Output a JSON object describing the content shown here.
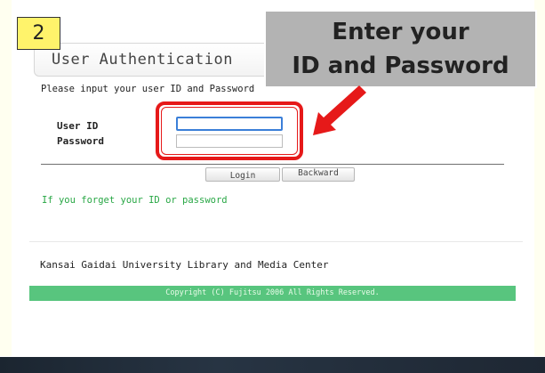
{
  "step_number": "2",
  "callout": {
    "line1": "Enter your",
    "line2": "ID and Password"
  },
  "auth": {
    "title": "User Authentication",
    "instruction": "Please input your user ID and Password",
    "user_id_label": "User ID",
    "password_label": "Password",
    "user_id_value": "",
    "password_value": "",
    "login_button": "Login",
    "backward_button": "Backward",
    "forgot_link": "If you forget your ID or password"
  },
  "footer": {
    "organization": "Kansai Gaidai University Library and Media Center",
    "copyright": "Copyright (C) Fujitsu 2006 All Rights Reserved."
  },
  "colors": {
    "highlight": "#e61919",
    "accent_green": "#58c57e",
    "link_green": "#28a745",
    "badge_yellow": "#fff36b"
  },
  "icons": {
    "pointer_arrow": "red-arrow-icon"
  }
}
